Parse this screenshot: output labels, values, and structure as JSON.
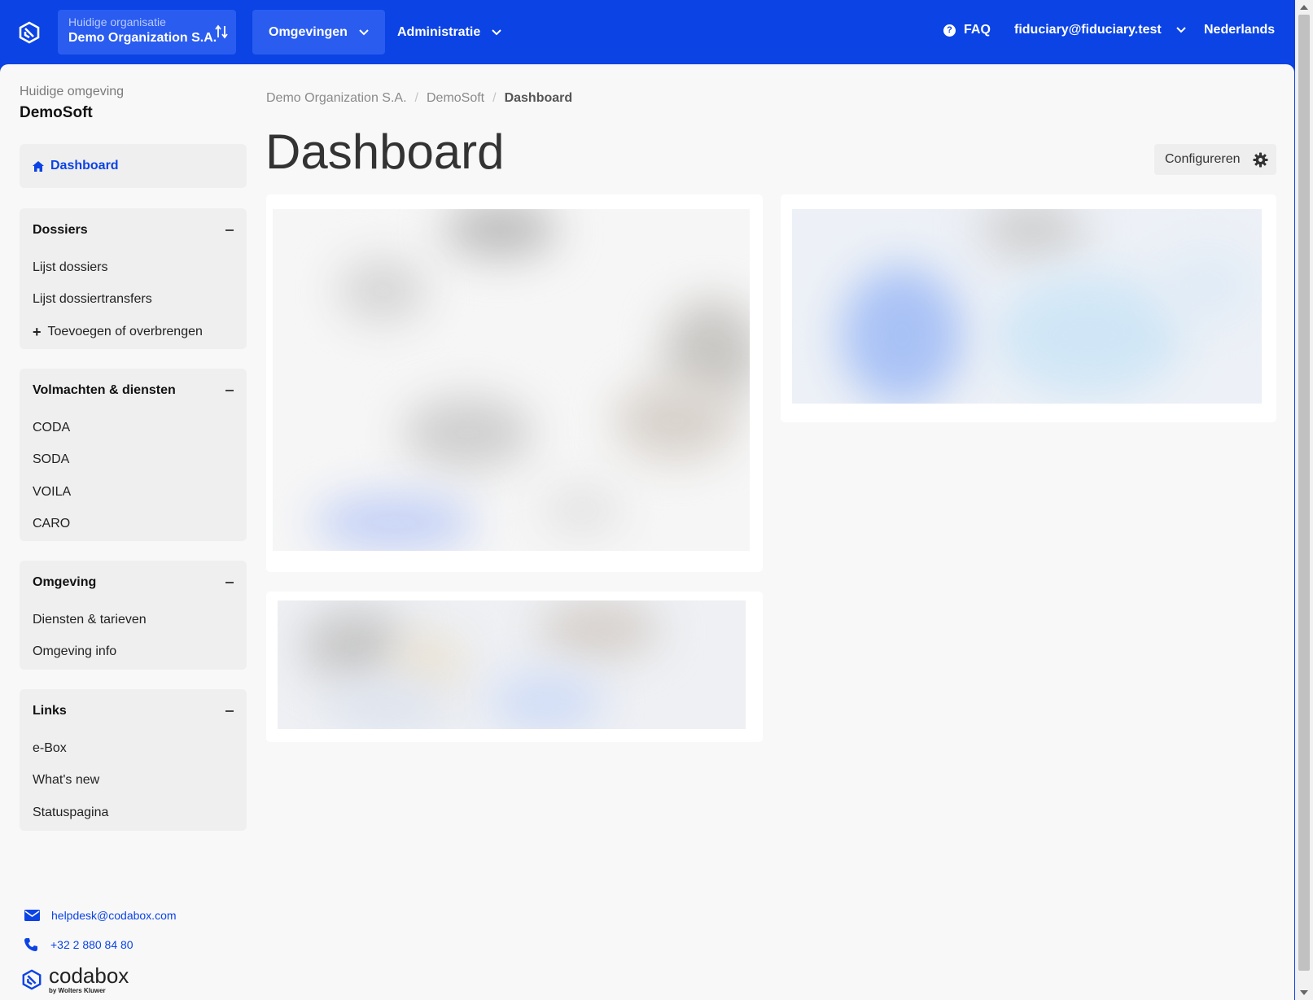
{
  "header": {
    "org_caption": "Huidige organisatie",
    "org_name": "Demo Organization S.A.",
    "nav": [
      "Omgevingen",
      "Administratie"
    ],
    "faq": "FAQ",
    "user": "fiduciary@fiduciary.test",
    "language": "Nederlands",
    "icons": [
      "codabox-logo-icon",
      "swap-icon",
      "chevron-down-icon",
      "question-circle-icon"
    ]
  },
  "sidebar": {
    "env_caption": "Huidige omgeving",
    "env_name": "DemoSoft",
    "dashboard_label": "Dashboard",
    "groups": [
      {
        "title": "Dossiers",
        "items": [
          "Lijst dossiers",
          "Lijst dossiertransfers",
          "Toevoegen of overbrengen"
        ]
      },
      {
        "title": "Volmachten & diensten",
        "items": [
          "CODA",
          "SODA",
          "VOILA",
          "CARO"
        ]
      },
      {
        "title": "Omgeving",
        "items": [
          "Diensten & tarieven",
          "Omgeving info"
        ]
      },
      {
        "title": "Links",
        "items": [
          "e-Box",
          "What's new",
          "Statuspagina"
        ]
      }
    ],
    "footer": {
      "email": "helpdesk@codabox.com",
      "phone": "+32 2 880 84 80",
      "brand": "codabox",
      "brand_sub": "by Wolters Kluwer"
    }
  },
  "main": {
    "breadcrumb": [
      "Demo Organization S.A.",
      "DemoSoft",
      "Dashboard"
    ],
    "title": "Dashboard",
    "configure_label": "Configureren"
  },
  "colors": {
    "brand_blue": "#0b43e4",
    "active_nav": "#2a5cf0",
    "page_bg": "#f8f8f8",
    "card_bg": "#efefef"
  }
}
